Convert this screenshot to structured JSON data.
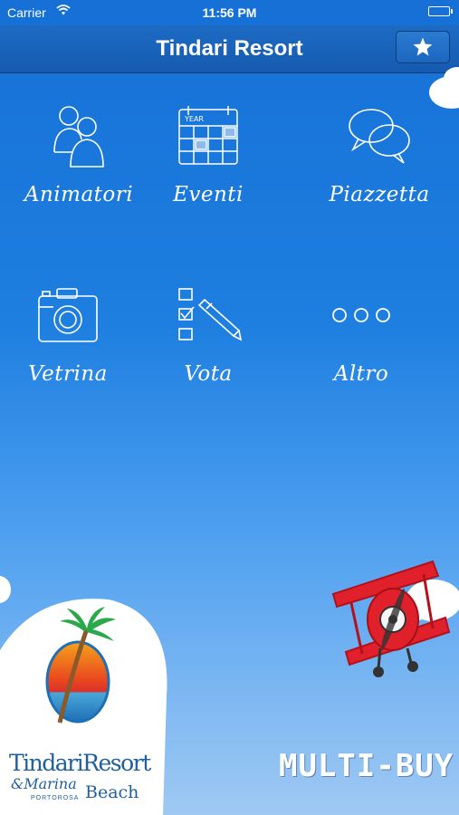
{
  "status_bar": {
    "carrier": "Carrier",
    "time": "11:56 PM"
  },
  "nav": {
    "title": "Tindari Resort",
    "favorite_icon": "star-icon"
  },
  "menu": [
    {
      "label": "Animatori",
      "icon": "people-icon"
    },
    {
      "label": "Eventi",
      "icon": "calendar-icon",
      "icon_text": "YEAR"
    },
    {
      "label": "Piazzetta",
      "icon": "chat-bubbles-icon"
    },
    {
      "label": "Vetrina",
      "icon": "camera-icon"
    },
    {
      "label": "Vota",
      "icon": "checklist-icon"
    },
    {
      "label": "Altro",
      "icon": "more-icon"
    }
  ],
  "logo": {
    "line1": "TindariResort",
    "line2a": "&Marina",
    "line2b": "Beach",
    "line3": "PORTOROSA"
  },
  "sponsor": {
    "name": "MULTI-BUY"
  },
  "colors": {
    "nav": "#165ab0",
    "background_top": "#1670d6",
    "background_bottom": "#9fc9f3",
    "plane": "#e0202a"
  }
}
